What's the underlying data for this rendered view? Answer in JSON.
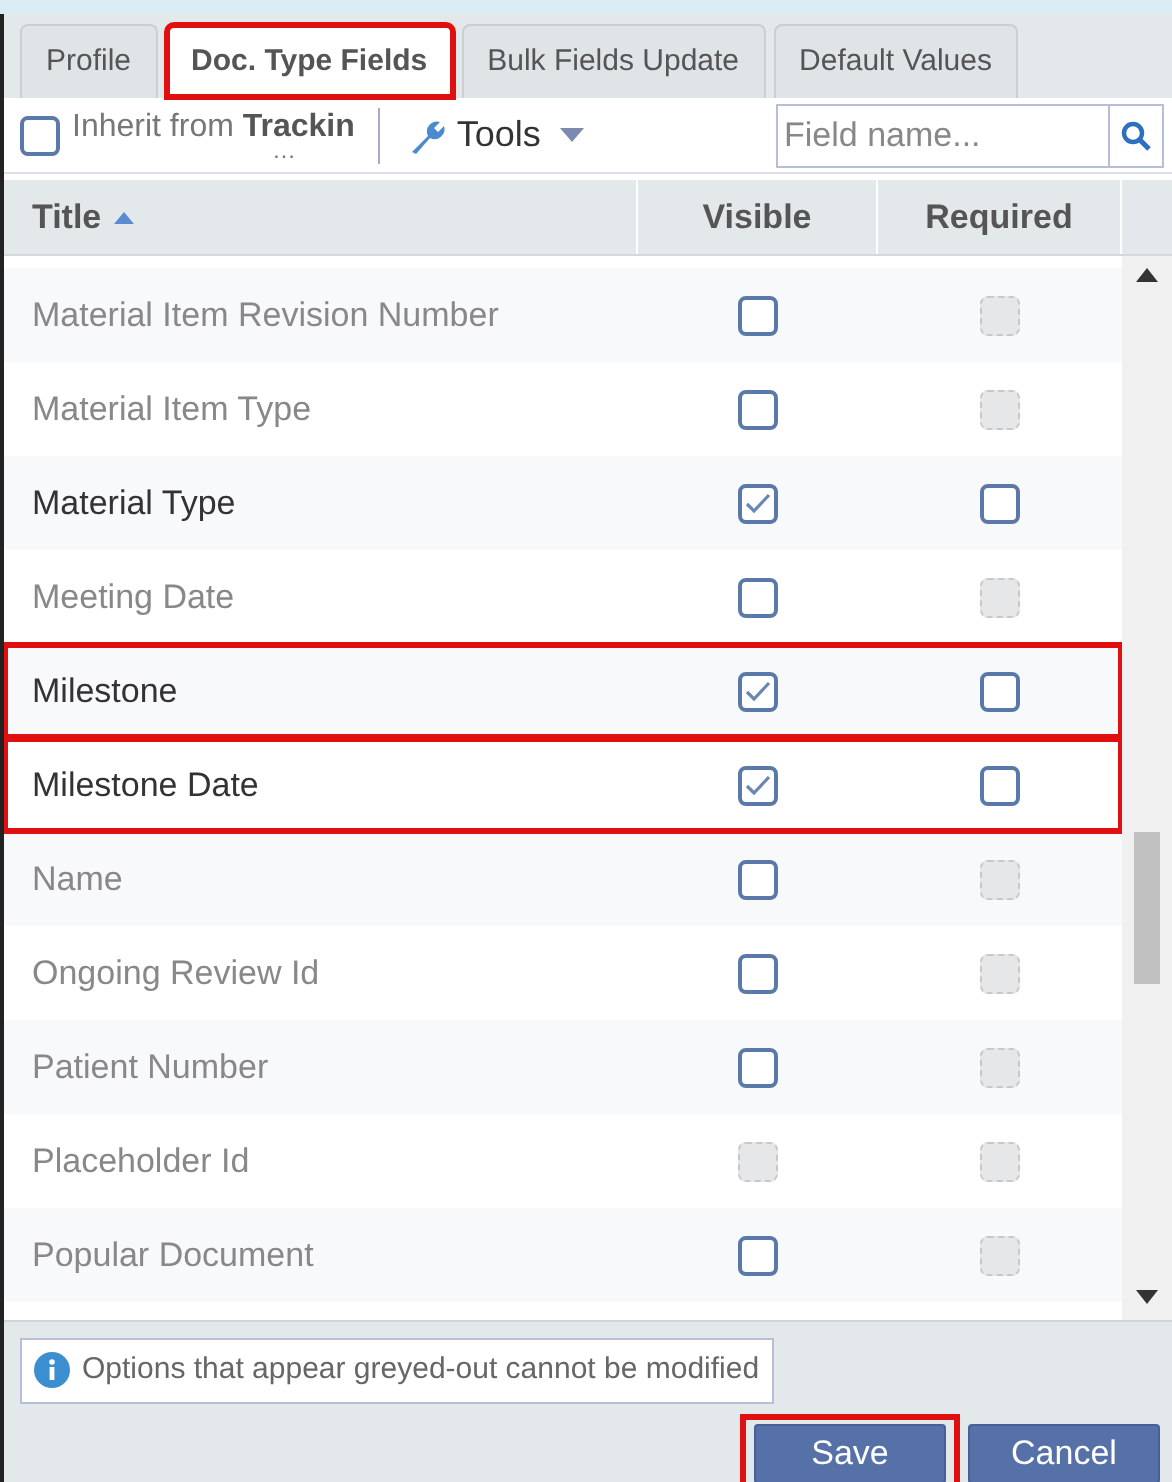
{
  "tabs": [
    {
      "label": "Profile",
      "selected": false,
      "highlighted": false
    },
    {
      "label": "Doc. Type Fields",
      "selected": true,
      "highlighted": true
    },
    {
      "label": "Bulk Fields Update",
      "selected": false,
      "highlighted": false
    },
    {
      "label": "Default Values",
      "selected": false,
      "highlighted": false
    }
  ],
  "toolbar": {
    "inherit": {
      "label": "Inherit from",
      "value": "Trackin",
      "ellipsis": "…",
      "checked": false
    },
    "tools": "Tools",
    "search": {
      "placeholder": "Field name..."
    }
  },
  "table": {
    "columns": [
      "Title",
      "Visible",
      "Required"
    ],
    "rows": [
      {
        "title": "Material Item Revision Number",
        "visible": false,
        "visible_disabled": false,
        "required": false,
        "required_disabled": true,
        "highlighted": false
      },
      {
        "title": "Material Item Type",
        "visible": false,
        "visible_disabled": false,
        "required": false,
        "required_disabled": true,
        "highlighted": false
      },
      {
        "title": "Material Type",
        "visible": true,
        "visible_disabled": false,
        "required": false,
        "required_disabled": false,
        "highlighted": false
      },
      {
        "title": "Meeting Date",
        "visible": false,
        "visible_disabled": false,
        "required": false,
        "required_disabled": true,
        "highlighted": false
      },
      {
        "title": "Milestone",
        "visible": true,
        "visible_disabled": false,
        "required": false,
        "required_disabled": false,
        "highlighted": true
      },
      {
        "title": "Milestone Date",
        "visible": true,
        "visible_disabled": false,
        "required": false,
        "required_disabled": false,
        "highlighted": true
      },
      {
        "title": "Name",
        "visible": false,
        "visible_disabled": false,
        "required": false,
        "required_disabled": true,
        "highlighted": false
      },
      {
        "title": "Ongoing Review Id",
        "visible": false,
        "visible_disabled": false,
        "required": false,
        "required_disabled": true,
        "highlighted": false
      },
      {
        "title": "Patient Number",
        "visible": false,
        "visible_disabled": false,
        "required": false,
        "required_disabled": true,
        "highlighted": false
      },
      {
        "title": "Placeholder Id",
        "visible": false,
        "visible_disabled": true,
        "required": false,
        "required_disabled": true,
        "highlighted": false
      },
      {
        "title": "Popular Document",
        "visible": false,
        "visible_disabled": false,
        "required": false,
        "required_disabled": true,
        "highlighted": false
      }
    ]
  },
  "info": "Options that appear greyed-out cannot be modified",
  "buttons": [
    {
      "label": "Save",
      "highlighted": true
    },
    {
      "label": "Cancel",
      "highlighted": false
    }
  ]
}
